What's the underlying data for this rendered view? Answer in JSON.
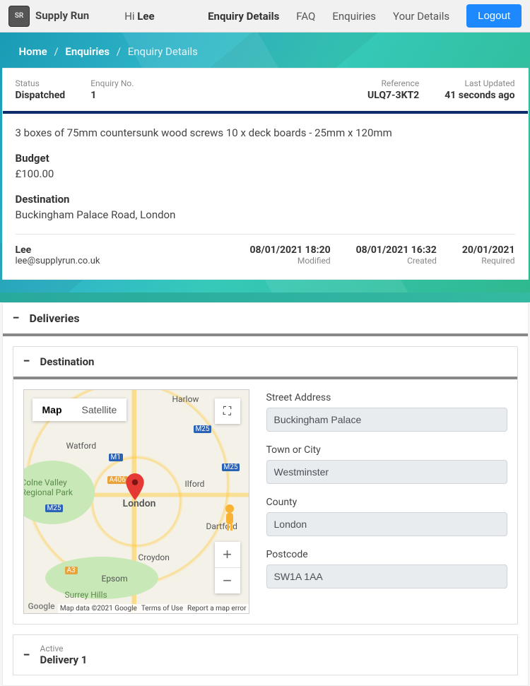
{
  "brand": "Supply Run",
  "greeting_prefix": "Hi ",
  "greeting_name": "Lee",
  "nav": {
    "enquiry_details": "Enquiry Details",
    "faq": "FAQ",
    "enquiries": "Enquiries",
    "your_details": "Your Details",
    "logout": "Logout"
  },
  "breadcrumb": {
    "home": "Home",
    "enquiries": "Enquiries",
    "current": "Enquiry Details"
  },
  "status": {
    "status_label": "Status",
    "status_value": "Dispatched",
    "enquiry_no_label": "Enquiry No.",
    "enquiry_no_value": "1",
    "reference_label": "Reference",
    "reference_value": "ULQ7-3KT2",
    "last_updated_label": "Last Updated",
    "last_updated_value": "41 seconds ago"
  },
  "enquiry": {
    "items_line": "3 boxes of 75mm countersunk wood screws 10 x deck boards - 25mm x 120mm",
    "budget_label": "Budget",
    "budget_value": "£100.00",
    "destination_label": "Destination",
    "destination_value": "Buckingham Palace Road, London",
    "contact_name": "Lee",
    "contact_email": "lee@supplyrun.co.uk",
    "modified_dt": "08/01/2021 18:20",
    "modified_label": "Modified",
    "created_dt": "08/01/2021 16:32",
    "created_label": "Created",
    "required_dt": "20/01/2021",
    "required_label": "Required"
  },
  "panels": {
    "deliveries_title": "Deliveries",
    "destination_title": "Destination",
    "delivery_active_label": "Active",
    "delivery_title": "Delivery 1"
  },
  "map": {
    "map_btn": "Map",
    "satellite_btn": "Satellite",
    "zoom_in": "+",
    "zoom_out": "−",
    "labels": {
      "harlow": "Harlow",
      "watford": "Watford",
      "london": "London",
      "ilford": "Ilford",
      "dartford": "Dartford",
      "croydon": "Croydon",
      "epsom": "Epsom",
      "surrey": "Surrey Hills",
      "colne": "Colne Valley Regional Park"
    },
    "roads": {
      "m25a": "M25",
      "m25b": "M25",
      "m25c": "M25",
      "m1": "M1",
      "a406": "A406",
      "a3": "A3"
    },
    "google": "Google",
    "attr_data": "Map data ©2021 Google",
    "attr_terms": "Terms of Use",
    "attr_report": "Report a map error"
  },
  "destination_form": {
    "street_label": "Street Address",
    "street_value": "Buckingham Palace",
    "town_label": "Town or City",
    "town_value": "Westminster",
    "county_label": "County",
    "county_value": "London",
    "postcode_label": "Postcode",
    "postcode_value": "SW1A 1AA"
  }
}
